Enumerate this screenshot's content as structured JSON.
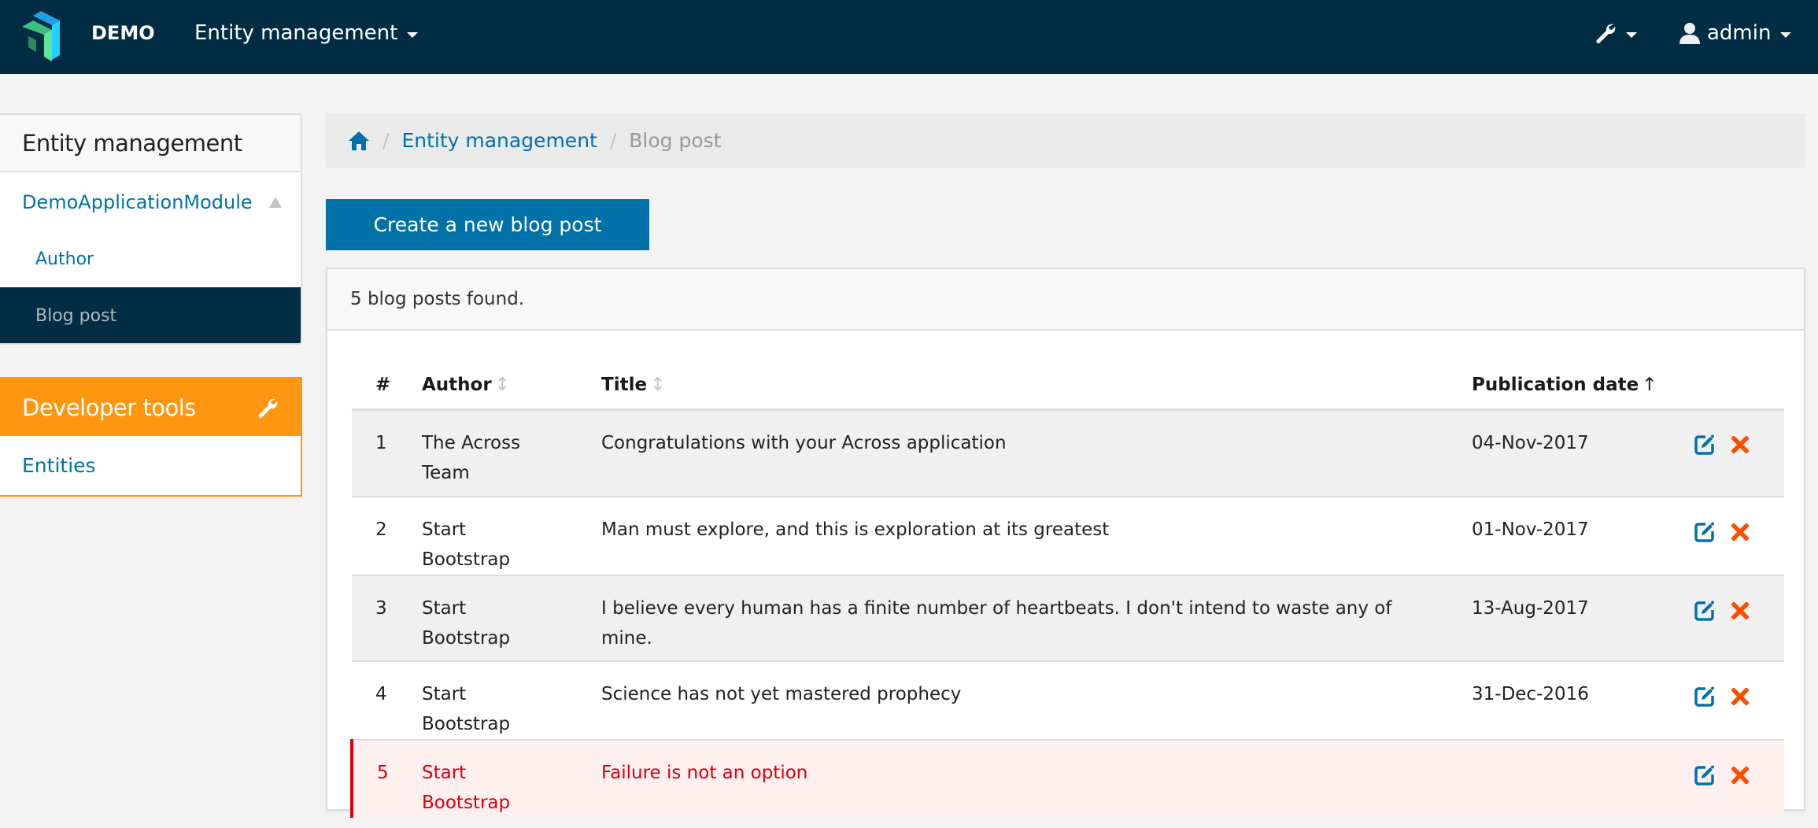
{
  "navbar": {
    "brand": "DEMO",
    "menu_label": "Entity management",
    "tools_icon": "wrench-icon",
    "user_label": "admin"
  },
  "sidebar": {
    "entity_panel": {
      "title": "Entity management",
      "module_label": "DemoApplicationModule",
      "items": [
        {
          "label": "Author",
          "active": false
        },
        {
          "label": "Blog post",
          "active": true
        }
      ]
    },
    "dev_panel": {
      "title": "Developer tools",
      "items": [
        {
          "label": "Entities"
        }
      ]
    }
  },
  "breadcrumb": {
    "home_icon": "home-icon",
    "items": [
      {
        "label": "Entity management",
        "link": true
      },
      {
        "label": "Blog post",
        "link": false
      }
    ]
  },
  "create_button": "Create a new blog post",
  "results": {
    "summary": "5 blog posts found.",
    "columns": [
      {
        "label": "#",
        "sort": "none"
      },
      {
        "label": "Author",
        "sort": "sortable"
      },
      {
        "label": "Title",
        "sort": "sortable"
      },
      {
        "label": "Publication date",
        "sort": "ascending"
      }
    ],
    "rows": [
      {
        "num": "1",
        "author": "The Across Team",
        "title": "Congratulations with your Across application",
        "date": "04-Nov-2017",
        "state": "normal"
      },
      {
        "num": "2",
        "author": "Start Bootstrap",
        "title": "Man must explore, and this is exploration at its greatest",
        "date": "01-Nov-2017",
        "state": "normal"
      },
      {
        "num": "3",
        "author": "Start Bootstrap",
        "title": "I believe every human has a finite number of heartbeats. I don't intend to waste any of mine.",
        "date": "13-Aug-2017",
        "state": "normal"
      },
      {
        "num": "4",
        "author": "Start Bootstrap",
        "title": "Science has not yet mastered prophecy",
        "date": "31-Dec-2016",
        "state": "normal"
      },
      {
        "num": "5",
        "author": "Start Bootstrap",
        "title": "Failure is not an option",
        "date": "",
        "state": "danger"
      }
    ]
  },
  "colors": {
    "navbar_bg": "#002d44",
    "primary": "#0072a8",
    "developer_tools": "#ff960f",
    "danger": "#d9000d",
    "delete_icon": "#ff4c00"
  }
}
